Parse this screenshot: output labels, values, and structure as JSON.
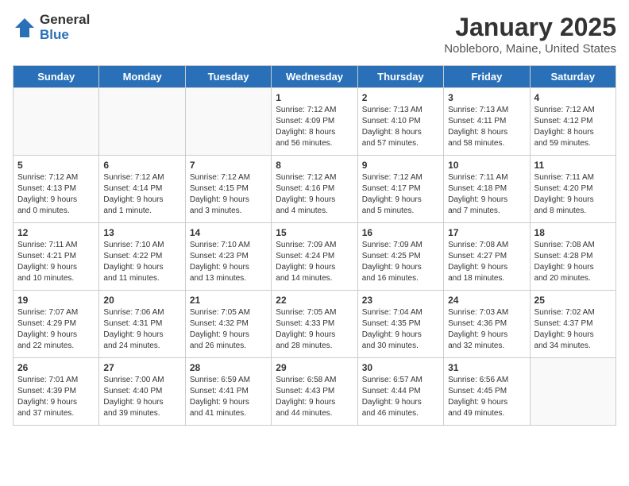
{
  "logo": {
    "general": "General",
    "blue": "Blue"
  },
  "title": "January 2025",
  "subtitle": "Nobleboro, Maine, United States",
  "days_of_week": [
    "Sunday",
    "Monday",
    "Tuesday",
    "Wednesday",
    "Thursday",
    "Friday",
    "Saturday"
  ],
  "weeks": [
    [
      {
        "day": "",
        "info": ""
      },
      {
        "day": "",
        "info": ""
      },
      {
        "day": "",
        "info": ""
      },
      {
        "day": "1",
        "info": "Sunrise: 7:12 AM\nSunset: 4:09 PM\nDaylight: 8 hours\nand 56 minutes."
      },
      {
        "day": "2",
        "info": "Sunrise: 7:13 AM\nSunset: 4:10 PM\nDaylight: 8 hours\nand 57 minutes."
      },
      {
        "day": "3",
        "info": "Sunrise: 7:13 AM\nSunset: 4:11 PM\nDaylight: 8 hours\nand 58 minutes."
      },
      {
        "day": "4",
        "info": "Sunrise: 7:12 AM\nSunset: 4:12 PM\nDaylight: 8 hours\nand 59 minutes."
      }
    ],
    [
      {
        "day": "5",
        "info": "Sunrise: 7:12 AM\nSunset: 4:13 PM\nDaylight: 9 hours\nand 0 minutes."
      },
      {
        "day": "6",
        "info": "Sunrise: 7:12 AM\nSunset: 4:14 PM\nDaylight: 9 hours\nand 1 minute."
      },
      {
        "day": "7",
        "info": "Sunrise: 7:12 AM\nSunset: 4:15 PM\nDaylight: 9 hours\nand 3 minutes."
      },
      {
        "day": "8",
        "info": "Sunrise: 7:12 AM\nSunset: 4:16 PM\nDaylight: 9 hours\nand 4 minutes."
      },
      {
        "day": "9",
        "info": "Sunrise: 7:12 AM\nSunset: 4:17 PM\nDaylight: 9 hours\nand 5 minutes."
      },
      {
        "day": "10",
        "info": "Sunrise: 7:11 AM\nSunset: 4:18 PM\nDaylight: 9 hours\nand 7 minutes."
      },
      {
        "day": "11",
        "info": "Sunrise: 7:11 AM\nSunset: 4:20 PM\nDaylight: 9 hours\nand 8 minutes."
      }
    ],
    [
      {
        "day": "12",
        "info": "Sunrise: 7:11 AM\nSunset: 4:21 PM\nDaylight: 9 hours\nand 10 minutes."
      },
      {
        "day": "13",
        "info": "Sunrise: 7:10 AM\nSunset: 4:22 PM\nDaylight: 9 hours\nand 11 minutes."
      },
      {
        "day": "14",
        "info": "Sunrise: 7:10 AM\nSunset: 4:23 PM\nDaylight: 9 hours\nand 13 minutes."
      },
      {
        "day": "15",
        "info": "Sunrise: 7:09 AM\nSunset: 4:24 PM\nDaylight: 9 hours\nand 14 minutes."
      },
      {
        "day": "16",
        "info": "Sunrise: 7:09 AM\nSunset: 4:25 PM\nDaylight: 9 hours\nand 16 minutes."
      },
      {
        "day": "17",
        "info": "Sunrise: 7:08 AM\nSunset: 4:27 PM\nDaylight: 9 hours\nand 18 minutes."
      },
      {
        "day": "18",
        "info": "Sunrise: 7:08 AM\nSunset: 4:28 PM\nDaylight: 9 hours\nand 20 minutes."
      }
    ],
    [
      {
        "day": "19",
        "info": "Sunrise: 7:07 AM\nSunset: 4:29 PM\nDaylight: 9 hours\nand 22 minutes."
      },
      {
        "day": "20",
        "info": "Sunrise: 7:06 AM\nSunset: 4:31 PM\nDaylight: 9 hours\nand 24 minutes."
      },
      {
        "day": "21",
        "info": "Sunrise: 7:05 AM\nSunset: 4:32 PM\nDaylight: 9 hours\nand 26 minutes."
      },
      {
        "day": "22",
        "info": "Sunrise: 7:05 AM\nSunset: 4:33 PM\nDaylight: 9 hours\nand 28 minutes."
      },
      {
        "day": "23",
        "info": "Sunrise: 7:04 AM\nSunset: 4:35 PM\nDaylight: 9 hours\nand 30 minutes."
      },
      {
        "day": "24",
        "info": "Sunrise: 7:03 AM\nSunset: 4:36 PM\nDaylight: 9 hours\nand 32 minutes."
      },
      {
        "day": "25",
        "info": "Sunrise: 7:02 AM\nSunset: 4:37 PM\nDaylight: 9 hours\nand 34 minutes."
      }
    ],
    [
      {
        "day": "26",
        "info": "Sunrise: 7:01 AM\nSunset: 4:39 PM\nDaylight: 9 hours\nand 37 minutes."
      },
      {
        "day": "27",
        "info": "Sunrise: 7:00 AM\nSunset: 4:40 PM\nDaylight: 9 hours\nand 39 minutes."
      },
      {
        "day": "28",
        "info": "Sunrise: 6:59 AM\nSunset: 4:41 PM\nDaylight: 9 hours\nand 41 minutes."
      },
      {
        "day": "29",
        "info": "Sunrise: 6:58 AM\nSunset: 4:43 PM\nDaylight: 9 hours\nand 44 minutes."
      },
      {
        "day": "30",
        "info": "Sunrise: 6:57 AM\nSunset: 4:44 PM\nDaylight: 9 hours\nand 46 minutes."
      },
      {
        "day": "31",
        "info": "Sunrise: 6:56 AM\nSunset: 4:45 PM\nDaylight: 9 hours\nand 49 minutes."
      },
      {
        "day": "",
        "info": ""
      }
    ]
  ]
}
